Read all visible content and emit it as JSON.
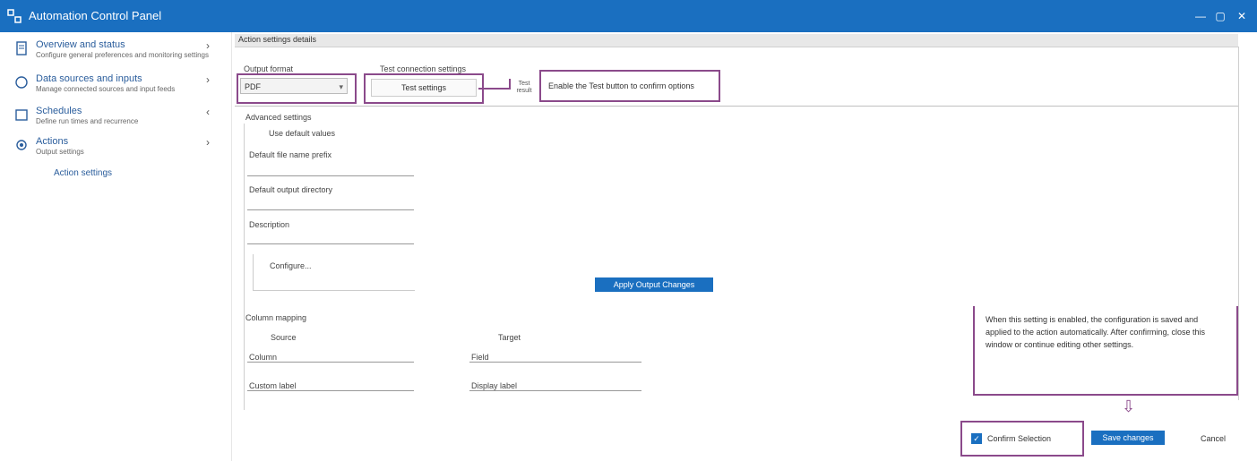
{
  "app": {
    "title": "Automation Control Panel"
  },
  "window": {
    "minimize": "—",
    "restore": "▢",
    "close": "✕"
  },
  "sidebar": {
    "items": [
      {
        "title": "Overview and status",
        "sub": "Configure general preferences and monitoring settings",
        "chevron": "›"
      },
      {
        "title": "Data sources and inputs",
        "sub": "Manage connected sources and input feeds",
        "chevron": "›"
      },
      {
        "title": "Schedules",
        "sub": "Define run times and recurrence",
        "chevron": "‹"
      },
      {
        "title": "Actions",
        "sub": "Output settings",
        "chevron": "›"
      }
    ],
    "link": "Action settings"
  },
  "panel": {
    "header": "Action settings details"
  },
  "form": {
    "field1_label": "Output format",
    "field1_value": "PDF",
    "field2_label": "Test connection settings",
    "test_button": "Test settings",
    "tag": "Test result",
    "callout": "Enable the Test button to confirm options",
    "section_label": "Advanced settings",
    "sub_label": "Use default values",
    "input1_label": "Default file name prefix",
    "input2_label": "Default output directory",
    "input3_label": "Description",
    "inner_button": "Configure...",
    "center_button": "Apply Output Changes",
    "section2_label": "Column mapping",
    "col1": "Source",
    "col2": "Target",
    "row1_left": "Column",
    "row1_right": "Field",
    "row2_left": "Custom label",
    "row2_right": "Display label"
  },
  "note": {
    "text": "When this setting is enabled, the configuration is saved and applied to the action automatically. After confirming, close this window or continue editing other settings."
  },
  "footer": {
    "checkbox_label": "Confirm Selection",
    "save_button": "Save changes",
    "cancel": "Cancel"
  },
  "colors": {
    "primary": "#1a6fc0",
    "callout": "#8b4a8b"
  }
}
